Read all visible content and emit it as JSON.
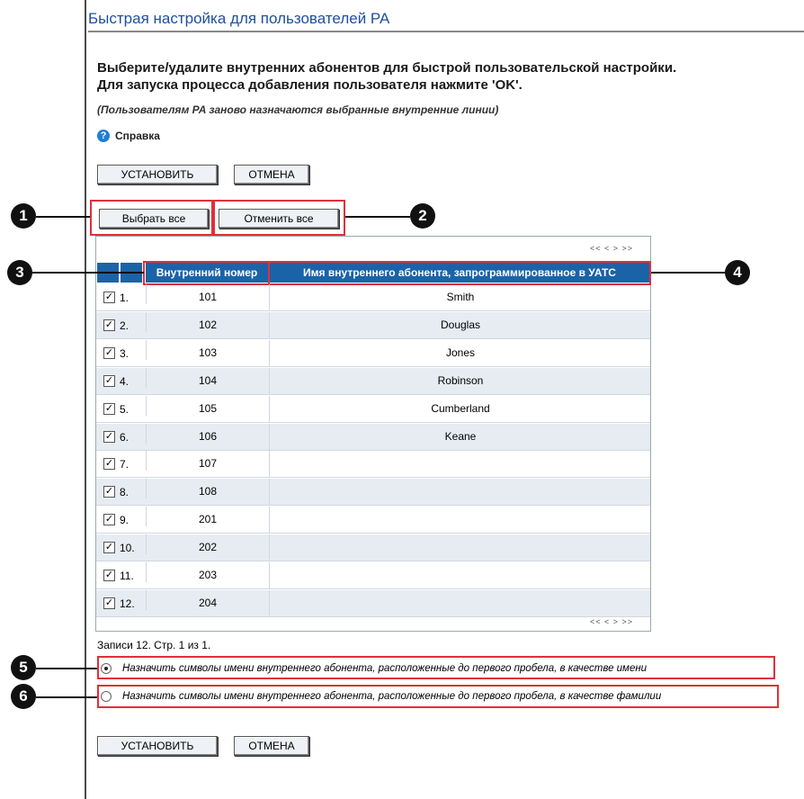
{
  "page": {
    "title": "Быстрая настройка для пользователей PA",
    "instruction_line1": "Выберите/удалите внутренних абонентов для быстрой пользовательской настройки.",
    "instruction_line2": "Для запуска процесса добавления пользователя нажмите 'OK'.",
    "note": "(Пользователям PA заново назначаются выбранные внутренние линии)",
    "help_label": "Справка",
    "help_icon": "?"
  },
  "toolbar_top": {
    "set_label": "УСТАНОВИТЬ",
    "cancel_label": "ОТМЕНА"
  },
  "selection": {
    "select_all": "Выбрать все",
    "deselect_all": "Отменить все"
  },
  "pager": {
    "top": "<< < > >>",
    "bottom": "<< < > >>"
  },
  "table": {
    "headers": {
      "extension": "Внутренний номер",
      "name": "Имя внутреннего абонента, запрограммированное в УАТС"
    },
    "rows": [
      {
        "checked": true,
        "index": "1.",
        "extension": "101",
        "name": "Smith"
      },
      {
        "checked": true,
        "index": "2.",
        "extension": "102",
        "name": "Douglas"
      },
      {
        "checked": true,
        "index": "3.",
        "extension": "103",
        "name": "Jones"
      },
      {
        "checked": true,
        "index": "4.",
        "extension": "104",
        "name": "Robinson"
      },
      {
        "checked": true,
        "index": "5.",
        "extension": "105",
        "name": "Cumberland"
      },
      {
        "checked": true,
        "index": "6.",
        "extension": "106",
        "name": "Keane"
      },
      {
        "checked": true,
        "index": "7.",
        "extension": "107",
        "name": ""
      },
      {
        "checked": true,
        "index": "8.",
        "extension": "108",
        "name": ""
      },
      {
        "checked": true,
        "index": "9.",
        "extension": "201",
        "name": ""
      },
      {
        "checked": true,
        "index": "10.",
        "extension": "202",
        "name": ""
      },
      {
        "checked": true,
        "index": "11.",
        "extension": "203",
        "name": ""
      },
      {
        "checked": true,
        "index": "12.",
        "extension": "204",
        "name": ""
      }
    ],
    "records_label": "Записи 12. Стр. 1 из 1."
  },
  "options": {
    "first_name": {
      "label": "Назначить символы имени внутреннего абонента, расположенные до первого пробела, в качестве имени",
      "selected": true
    },
    "last_name": {
      "label": "Назначить символы имени внутреннего абонента, расположенные до первого пробела, в качестве фамилии",
      "selected": false
    }
  },
  "toolbar_bottom": {
    "set_label": "УСТАНОВИТЬ",
    "cancel_label": "ОТМЕНА"
  },
  "callouts": [
    "1",
    "2",
    "3",
    "4",
    "5",
    "6"
  ],
  "colors": {
    "header_bg": "#1b63a8",
    "title": "#1f4f9a",
    "callout_border": "#e0303a",
    "alt_row": "#e6ecf2"
  }
}
